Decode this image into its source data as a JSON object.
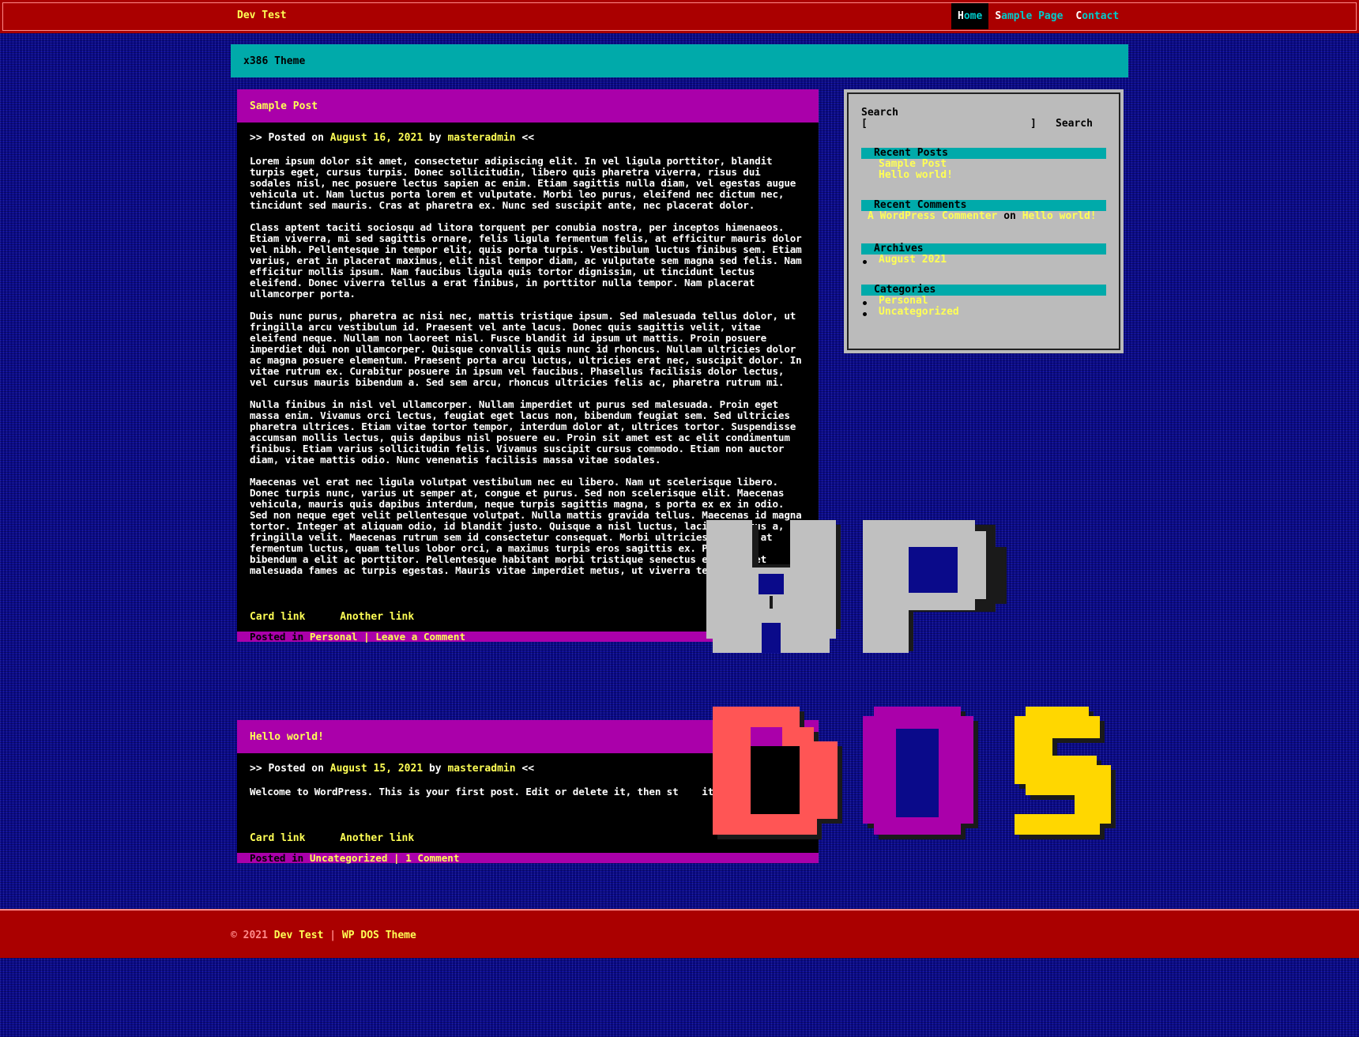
{
  "header": {
    "site_title": "Dev Test",
    "nav": [
      {
        "key": "H",
        "rest": "ome"
      },
      {
        "key": "S",
        "rest": "ample Page"
      },
      {
        "key": "C",
        "rest": "ontact"
      }
    ]
  },
  "theme_title": "x386 Theme",
  "posts": [
    {
      "title": "Sample Post",
      "meta_prefix": ">> Posted on",
      "date": "August 16, 2021",
      "by": "by",
      "author": "masteradmin",
      "meta_suffix": "<<",
      "paragraphs": [
        "Lorem ipsum dolor sit amet, consectetur adipiscing elit. In vel ligula porttitor, blandit turpis eget, cursus turpis. Donec sollicitudin, libero quis pharetra viverra, risus dui sodales nisl, nec posuere lectus sapien ac enim. Etiam sagittis nulla diam, vel egestas augue vehicula ut. Nam luctus porta lorem et vulputate. Morbi leo purus, eleifend nec dictum nec, tincidunt sed mauris. Cras at pharetra ex. Nunc sed suscipit ante, nec placerat dolor.",
        "Class aptent taciti sociosqu ad litora torquent per conubia nostra, per inceptos himenaeos. Etiam viverra, mi sed sagittis ornare, felis ligula fermentum felis, at efficitur mauris dolor vel nibh. Pellentesque in tempor elit, quis porta turpis. Vestibulum luctus finibus sem. Etiam varius, erat in placerat maximus, elit nisl tempor diam, ac vulputate sem magna sed felis. Nam efficitur mollis ipsum. Nam faucibus ligula quis tortor dignissim, ut tincidunt lectus eleifend. Donec viverra tellus a erat finibus, in porttitor nulla tempor. Nam placerat ullamcorper porta.",
        "Duis nunc purus, pharetra ac nisi nec, mattis tristique ipsum. Sed malesuada tellus dolor, ut fringilla arcu vestibulum id. Praesent vel ante lacus. Donec quis sagittis velit, vitae eleifend neque. Nullam non laoreet nisl. Fusce blandit id ipsum ut mattis. Proin posuere imperdiet dui non ullamcorper. Quisque convallis quis nunc id rhoncus. Nullam ultricies dolor ac magna posuere elementum. Praesent porta arcu luctus, ultricies erat nec, suscipit dolor. In vitae rutrum ex. Curabitur posuere in ipsum vel faucibus. Phasellus facilisis dolor lectus, vel cursus mauris bibendum a. Sed sem arcu, rhoncus ultricies felis ac, pharetra rutrum mi.",
        "Nulla finibus in nisl vel ullamcorper. Nullam imperdiet ut purus sed malesuada. Proin eget massa enim. Vivamus orci lectus, feugiat eget lacus non, bibendum feugiat sem. Sed ultricies pharetra ultrices. Etiam vitae tortor tempor, interdum dolor at, ultrices tortor. Suspendisse accumsan mollis lectus, quis dapibus nisl posuere eu. Proin sit amet est ac elit condimentum finibus. Etiam varius sollicitudin felis. Vivamus suscipit cursus commodo. Etiam non auctor diam, vitae mattis odio. Nunc venenatis facilisis massa vitae sodales.",
        "Maecenas vel erat nec ligula volutpat vestibulum nec eu libero. Nam ut scelerisque libero. Donec turpis nunc, varius ut semper at, congue et purus. Sed non scelerisque elit. Maecenas vehicula, mauris quis dapibus interdum, neque turpis sagittis magna, s porta ex ex in odio. Sed non neque eget velit pellentesque volutpat. Nulla mattis gravida tellus. Maecenas id magna tortor. Integer at aliquam odio, id blandit justo. Quisque a nisl luctus, lacinia lectus a, fringilla velit. Maecenas rutrum sem id consectetur consequat. Morbi ultricies, ligula at fermentum luctus, quam tellus lobor orci, a maximus turpis eros sagittis ex. Phasellus bibendum a elit ac porttitor. Pellentesque habitant morbi tristique senectus et netus et malesuada fames ac turpis egestas. Mauris vitae imperdiet metus, ut viverra tellus."
      ],
      "link1": "Card link",
      "link2": "Another link",
      "footer_prefix": "Posted in",
      "category": "Personal",
      "sep": "|",
      "comment_link": "Leave a Comment"
    },
    {
      "title": "Hello world!",
      "meta_prefix": ">> Posted on",
      "date": "August 15, 2021",
      "by": "by",
      "author": "masteradmin",
      "meta_suffix": "<<",
      "paragraphs": [
        "Welcome to WordPress. This is your first post. Edit or delete it, then st    iting!"
      ],
      "link1": "Card link",
      "link2": "Another link",
      "footer_prefix": "Posted in",
      "category": "Uncategorized",
      "sep": "|",
      "comment_link": "1 Comment"
    }
  ],
  "sidebar": {
    "search_label": "Search",
    "search_field_left": "[",
    "search_field_right": "]",
    "search_button": "Search",
    "recent_posts_title": "Recent Posts",
    "recent_posts": [
      "Sample Post",
      "Hello world!"
    ],
    "recent_comments_title": "Recent Comments",
    "comment_author": "A WordPress Commenter",
    "comment_on": "on",
    "comment_post": "Hello world!",
    "archives_title": "Archives",
    "archives": [
      "August 2021"
    ],
    "categories_title": "Categories",
    "categories": [
      "Personal",
      "Uncategorized"
    ]
  },
  "footer": {
    "copyright": "© 2021",
    "site": "Dev Test",
    "sep": "|",
    "theme": "WP DOS Theme"
  },
  "logo": {
    "line1": "WP",
    "line2": "DOS",
    "colors": {
      "wp": "#c0c0c0",
      "d": "#ff5555",
      "o": "#aa00aa",
      "s": "#ffd700",
      "shadow": "#1a1a1a"
    }
  },
  "colors": {
    "background": "#0a0a8a",
    "topbar": "#aa0000",
    "accent": "#00aaaa",
    "post_header": "#aa00aa",
    "link": "#ffff55"
  }
}
